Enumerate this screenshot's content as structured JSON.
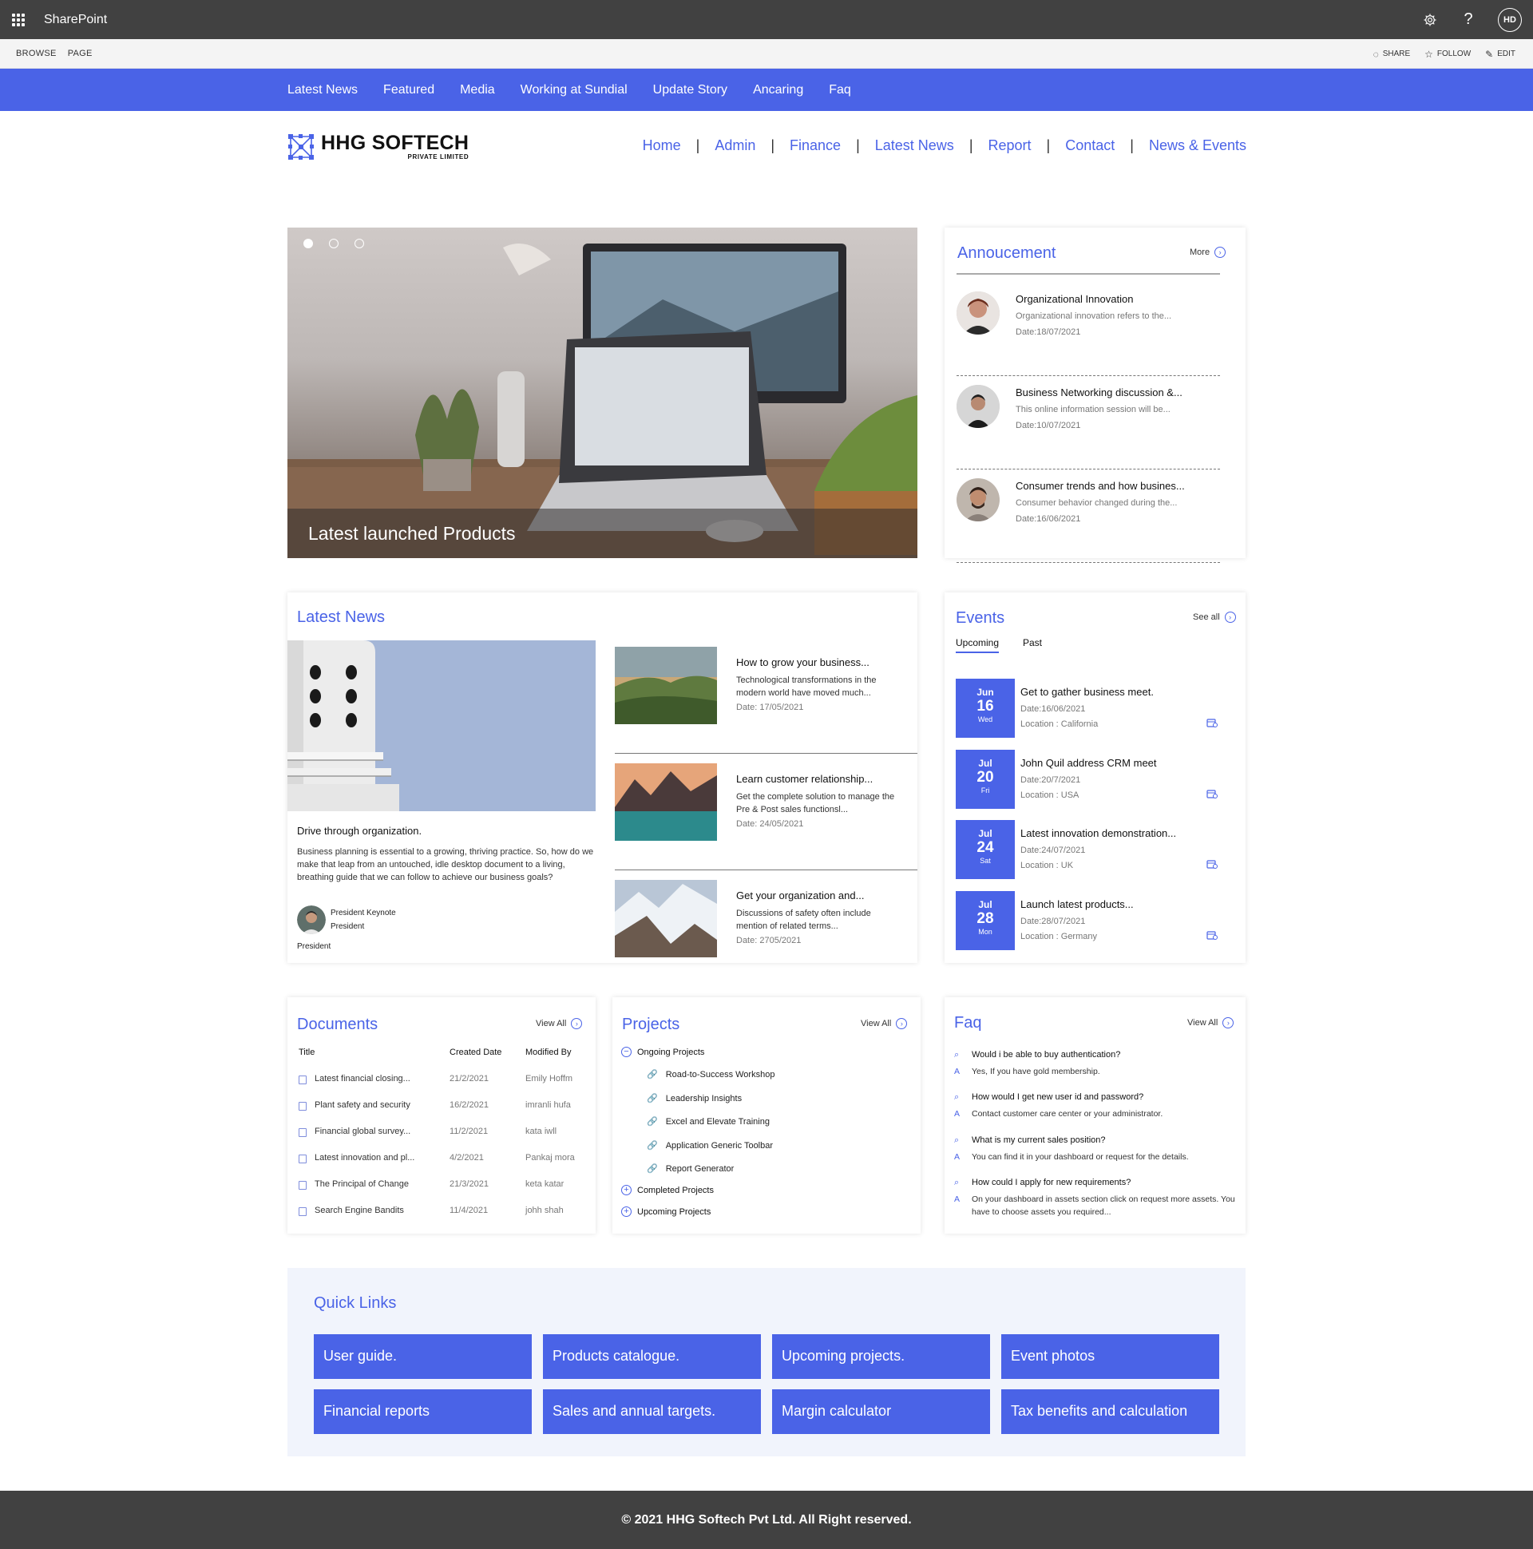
{
  "suite": {
    "title": "SharePoint",
    "user_initials": "HD",
    "help": "?"
  },
  "ribbon": {
    "tabs": [
      "BROWSE",
      "PAGE"
    ],
    "share": "SHARE",
    "follow": "FOLLOW",
    "edit": "EDIT"
  },
  "topnav": [
    "Latest News",
    "Featured",
    "Media",
    "Working at Sundial",
    "Update Story",
    "Ancaring",
    "Faq"
  ],
  "logo": {
    "name": "HHG SOFTECH",
    "sub": "PRIVATE LIMITED"
  },
  "mainnav": [
    "Home",
    "Admin",
    "Finance",
    "Latest News",
    "Report",
    "Contact",
    "News & Events"
  ],
  "mainnav_sep": "|",
  "hero": {
    "caption": "Latest launched Products"
  },
  "announcement": {
    "title": "Annoucement",
    "more": "More",
    "items": [
      {
        "title": "Organizational Innovation",
        "desc": "Organizational innovation refers to the...",
        "date": "Date:18/07/2021"
      },
      {
        "title": "Business Networking discussion &...",
        "desc": "This online information session will be...",
        "date": "Date:10/07/2021"
      },
      {
        "title": "Consumer trends and how busines...",
        "desc": "Consumer behavior changed during the...",
        "date": "Date:16/06/2021"
      }
    ]
  },
  "latest_news": {
    "title": "Latest News",
    "featured": {
      "title": "Drive through organization.",
      "body": "Business planning is essential to a growing, thriving practice. So, how do we make that leap from an untouched, idle desktop document to a living, breathing guide that we can follow to achieve our business goals?",
      "author_name": "President Keynote",
      "author_role": "President",
      "footer": "President"
    },
    "items": [
      {
        "title": "How to grow your  business...",
        "desc": "Technological transformations in the modern world have moved much...",
        "date": "Date: 17/05/2021"
      },
      {
        "title": "Learn customer relationship...",
        "desc": "Get the complete solution to manage the Pre & Post sales functionsl...",
        "date": "Date: 24/05/2021"
      },
      {
        "title": "Get your organization and...",
        "desc": "Discussions of safety often include mention of related terms...",
        "date": "Date: 2705/2021"
      }
    ]
  },
  "events": {
    "title": "Events",
    "see_all": "See all",
    "tabs": [
      "Upcoming",
      "Past"
    ],
    "items": [
      {
        "mon": "Jun",
        "day": "16",
        "wd": "Wed",
        "title": "Get to gather business meet.",
        "date": "Date:16/06/2021",
        "loc": "Location : California"
      },
      {
        "mon": "Jul",
        "day": "20",
        "wd": "Fri",
        "title": "John Quil address CRM meet",
        "date": "Date:20/7/2021",
        "loc": "Location : USA"
      },
      {
        "mon": "Jul",
        "day": "24",
        "wd": "Sat",
        "title": "Latest innovation demonstration...",
        "date": "Date:24/07/2021",
        "loc": "Location : UK"
      },
      {
        "mon": "Jul",
        "day": "28",
        "wd": "Mon",
        "title": "Launch  latest products...",
        "date": "Date:28/07/2021",
        "loc": "Location : Germany"
      }
    ]
  },
  "documents": {
    "title": "Documents",
    "view_all": "View All",
    "headers": [
      "Title",
      "Created Date",
      "Modified By"
    ],
    "rows": [
      {
        "title": "Latest financial closing...",
        "created": "21/2/2021",
        "by": "Emily Hoffm"
      },
      {
        "title": "Plant safety and security",
        "created": "16/2/2021",
        "by": "imranli hufa"
      },
      {
        "title": "Financial global survey...",
        "created": "11/2/2021",
        "by": "kata iwll"
      },
      {
        "title": "Latest innovation and pl...",
        "created": "4/2/2021",
        "by": "Pankaj mora"
      },
      {
        "title": "The Principal of Change",
        "created": "21/3/2021",
        "by": "keta katar"
      },
      {
        "title": "Search Engine Bandits",
        "created": "11/4/2021",
        "by": "johh shah"
      }
    ]
  },
  "projects": {
    "title": "Projects",
    "view_all": "View All",
    "ongoing": "Ongoing Projects",
    "ongoing_items": [
      "Road-to-Success Workshop",
      "Leadership Insights",
      "Excel and Elevate Training",
      "Application Generic Toolbar",
      "Report Generator"
    ],
    "completed": "Completed Projects",
    "upcoming": "Upcoming Projects"
  },
  "faq": {
    "title": "Faq",
    "view_all": "View All",
    "q_mark": "Q",
    "a_mark": "A",
    "items": [
      {
        "q": "Would i be able to buy authentication?",
        "a": "Yes, If you have gold membership."
      },
      {
        "q": "How would I get new user id and password?",
        "a": "Contact customer care center or your administrator."
      },
      {
        "q": "What is my current sales position?",
        "a": "You can find it in your dashboard or request for the details."
      },
      {
        "q": "How could I apply for new requirements?",
        "a": "On your dashboard in assets section click on request more assets. You have to choose assets you required..."
      }
    ]
  },
  "quick_links": {
    "title": "Quick Links",
    "items": [
      "User guide.",
      "Products catalogue.",
      "Upcoming projects.",
      "Event photos",
      "Financial reports",
      "Sales and annual targets.",
      "Margin calculator",
      "Tax benefits and calculation"
    ]
  },
  "footer": "© 2021 HHG Softech Pvt Ltd. All Right reserved.",
  "colors": {
    "accent": "#4a63e7",
    "suite_bar": "#414141",
    "quick_links_bg": "#f1f4fc"
  }
}
